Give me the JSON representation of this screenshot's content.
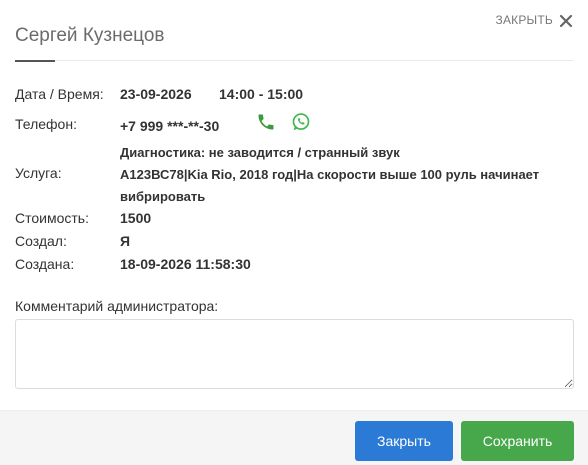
{
  "header": {
    "close_label": "ЗАКРЫТЬ",
    "title": "Сергей Кузнецов"
  },
  "details": {
    "datetime_label": "Дата / Время:",
    "date_value": "23-09-2026",
    "time_value": "14:00 - 15:00",
    "phone_label": "Телефон:",
    "phone_value": "+7 999 ***-**-30",
    "service_label": "Услуга:",
    "service_line1": "Диагностика: не заводится / странный звук",
    "service_line2": "А123ВС78|Kia Rio, 2018 год|На скорости выше 100 руль начинает вибрировать",
    "cost_label": "Стоимость:",
    "cost_value": "1500",
    "created_by_label": "Создал:",
    "created_by_value": "Я",
    "created_at_label": "Создана:",
    "created_at_value": "18-09-2026 11:58:30"
  },
  "comment": {
    "label": "Комментарий администратора:",
    "value": ""
  },
  "footer": {
    "close_button": "Закрыть",
    "save_button": "Сохранить"
  },
  "icons": {
    "phone": "phone-icon",
    "whatsapp": "whatsapp-icon",
    "close": "close-icon"
  },
  "colors": {
    "primary": "#2a7ad6",
    "success": "#46a84a",
    "phone_icon": "#3a9a3e",
    "whatsapp_icon": "#3db84b"
  }
}
